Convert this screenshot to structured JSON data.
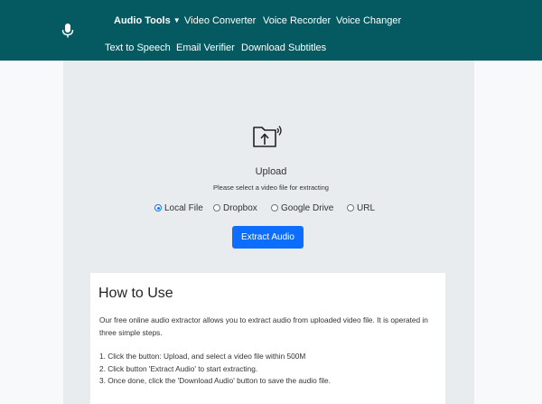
{
  "nav": {
    "row1": [
      {
        "label": "Audio Tools",
        "active": true
      },
      {
        "label": "Video Converter"
      },
      {
        "label": "Voice Recorder"
      },
      {
        "label": "Voice Changer"
      }
    ],
    "row2": [
      {
        "label": "Text to Speech"
      },
      {
        "label": "Email Verifier"
      },
      {
        "label": "Download Subtitles"
      }
    ]
  },
  "upload": {
    "title": "Upload",
    "subtitle": "Please select a video file for extracting"
  },
  "sources": [
    {
      "label": "Local File",
      "checked": true
    },
    {
      "label": "Dropbox",
      "checked": false
    },
    {
      "label": "Google Drive",
      "checked": false
    },
    {
      "label": "URL",
      "checked": false
    }
  ],
  "extract_button": "Extract Audio",
  "how_to": {
    "heading": "How to Use",
    "intro": "Our free online audio extractor allows you to extract audio from uploaded video file. It is operated in three simple steps.",
    "steps": [
      "1. Click the button: Upload, and select a video file within 500M",
      "2. Click button 'Extract Audio' to start extracting.",
      "3. Once done, click the 'Download Audio' button to save the audio file."
    ]
  },
  "colors": {
    "header": "#055a61",
    "primary": "#0d6efd",
    "panel": "#e9ecef"
  }
}
